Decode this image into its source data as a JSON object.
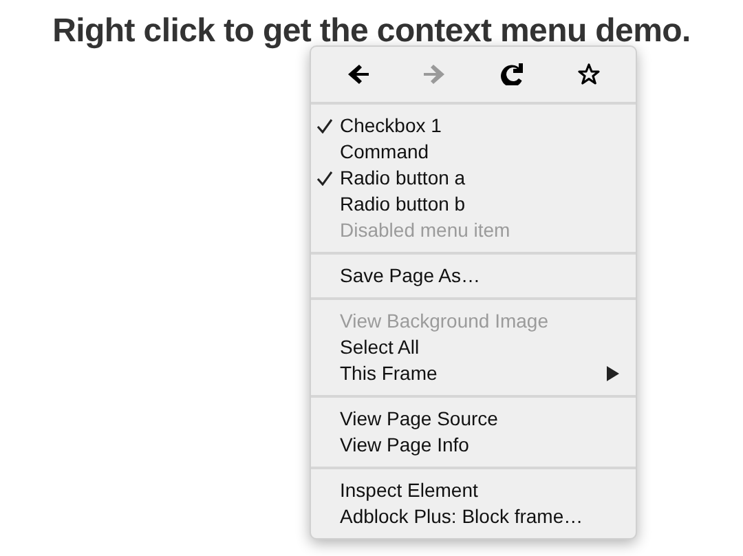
{
  "heading": "Right click to get the context menu demo.",
  "menu": {
    "toolbar": [
      {
        "kind": "back",
        "disabled": false
      },
      {
        "kind": "forward",
        "disabled": true
      },
      {
        "kind": "reload",
        "disabled": false
      },
      {
        "kind": "bookmark",
        "disabled": false
      }
    ],
    "sections": [
      [
        {
          "label": "Checkbox 1",
          "kind": "item",
          "checked": true,
          "disabled": false
        },
        {
          "label": "Command",
          "kind": "item",
          "checked": false,
          "disabled": false
        },
        {
          "label": "Radio button a",
          "kind": "item",
          "checked": true,
          "disabled": false
        },
        {
          "label": "Radio button b",
          "kind": "item",
          "checked": false,
          "disabled": false
        },
        {
          "label": "Disabled menu item",
          "kind": "item",
          "checked": false,
          "disabled": true
        }
      ],
      [
        {
          "label": "Save Page As…",
          "kind": "item",
          "checked": false,
          "disabled": false
        }
      ],
      [
        {
          "label": "View Background Image",
          "kind": "item",
          "checked": false,
          "disabled": true
        },
        {
          "label": "Select All",
          "kind": "item",
          "checked": false,
          "disabled": false
        },
        {
          "label": "This Frame",
          "kind": "submenu",
          "checked": false,
          "disabled": false
        }
      ],
      [
        {
          "label": "View Page Source",
          "kind": "item",
          "checked": false,
          "disabled": false
        },
        {
          "label": "View Page Info",
          "kind": "item",
          "checked": false,
          "disabled": false
        }
      ],
      [
        {
          "label": "Inspect Element",
          "kind": "item",
          "checked": false,
          "disabled": false
        },
        {
          "label": "Adblock Plus: Block frame…",
          "kind": "item",
          "checked": false,
          "disabled": false
        }
      ]
    ]
  }
}
